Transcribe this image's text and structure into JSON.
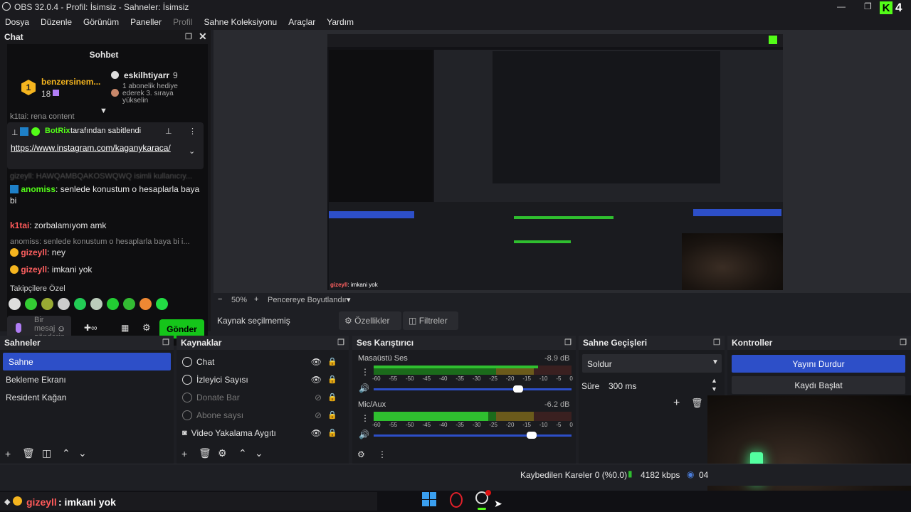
{
  "window": {
    "title": "OBS 32.0.4 - Profil: İsimsiz - Sahneler: İsimsiz"
  },
  "menu": [
    "Dosya",
    "Düzenle",
    "Görünüm",
    "Paneller",
    "Profil",
    "Sahne Koleksiyonu",
    "Araçlar",
    "Yardım"
  ],
  "chat": {
    "dock_title": "Chat",
    "header": "Sohbet",
    "leader1_name": "benzersinem...",
    "leader1_count": "18",
    "leader2_name": "eskilhtiyarr",
    "leader2_count": "9",
    "leader2_text": "1 abonelik hediye ederek 3. sıraya yükselin",
    "trunc_line": "k1tai: rena content",
    "pin_by": "BotRix",
    "pin_label": "tarafından sabitlendi",
    "pin_link": "https://www.instagram.com/kaganykaraca/",
    "blurred_line": "gizeyll: HAWQAMBQAKOSWQWQ isimli kullanıcıy...",
    "msg1_user": "anomiss",
    "msg1_text": ": senlede konustum o hesaplarla baya bi",
    "msg2_user": "k1tai",
    "msg2_text": ": zorbalamıyom amk",
    "reply_line": "anomiss: senlede konustum o hesaplarla baya bi i...",
    "msg3_user": "gizeyll",
    "msg3_text": ": ney",
    "msg4_user": "gizeyll",
    "msg4_text": ": imkani yok",
    "followers_label": "Takipçilere Özel",
    "input_placeholder": "Bir mesaj gönderin",
    "send_label": "Gönder"
  },
  "preview": {
    "zoom": "50%",
    "fit_label": "Pencereye Boyutlandır"
  },
  "source_bar": {
    "no_source": "Kaynak seçilmemiş",
    "properties": "Özellikler",
    "filters": "Filtreler"
  },
  "scenes": {
    "title": "Sahneler",
    "items": [
      "Sahne",
      "Bekleme Ekranı",
      "Resident Kağan"
    ]
  },
  "sources": {
    "title": "Kaynaklar",
    "items": [
      "Chat",
      "İzleyici Sayısı",
      "Donate Bar",
      "Abone saysı",
      "Video Yakalama Aygıtı"
    ]
  },
  "mixer": {
    "title": "Ses Karıştırıcı",
    "ch1_name": "Masaüstü Ses",
    "ch1_db": "-8.9 dB",
    "ch1_level": 0.83,
    "ch1_volume": 0.73,
    "ch2_name": "Mic/Aux",
    "ch2_db": "-6.2 dB",
    "ch2_level": 0.58,
    "ch2_volume": 0.8,
    "ticks": [
      "-60",
      "-55",
      "-50",
      "-45",
      "-40",
      "-35",
      "-30",
      "-25",
      "-20",
      "-15",
      "-10",
      "-5",
      "0"
    ]
  },
  "transitions": {
    "title": "Sahne Geçişleri",
    "type": "Soldur",
    "duration_label": "Süre",
    "duration_value": "300 ms"
  },
  "controls": {
    "title": "Kontroller",
    "stream": "Yayını Durdur",
    "record": "Kaydı Başlat"
  },
  "status": {
    "dropped": "Kaybedilen Kareler 0 (%0.0)",
    "bitrate": "4182 kbps",
    "extra": "04"
  },
  "overlay": {
    "user": "gizeyll",
    "text": ": imkani yok"
  },
  "colors": {
    "accent": "#2d4fc8",
    "send": "#15c51a",
    "green_meter": "#2fbf2f",
    "kick_green": "#53fc18"
  },
  "icons": [
    "minimize-icon",
    "restore-icon",
    "kick-logo-icon",
    "eye-icon",
    "lock-icon",
    "plus-icon",
    "trash-icon",
    "gear-icon",
    "chevron-up-icon",
    "chevron-down-icon",
    "speaker-icon",
    "dots-icon",
    "windows-start-icon",
    "opera-icon",
    "obs-icon"
  ]
}
